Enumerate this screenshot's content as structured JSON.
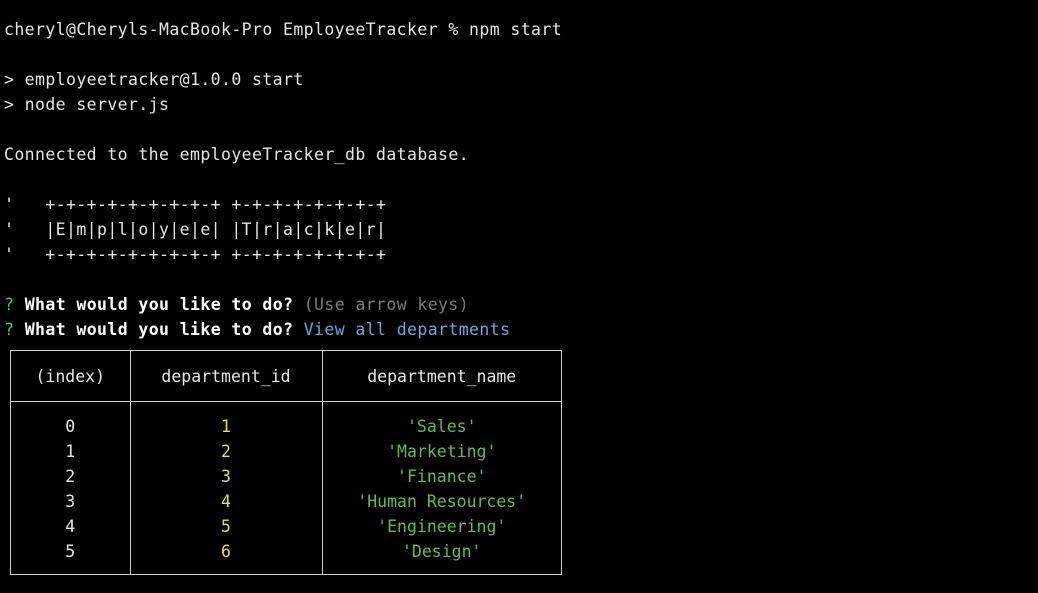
{
  "terminal": {
    "prompt_cmd": "cheryl@Cheryls-MacBook-Pro EmployeeTracker % npm start",
    "npm_line1": "> employeetracker@1.0.0 start",
    "npm_line2": "> node server.js",
    "connected": "Connected to the employeeTracker_db database.",
    "banner_top": "'   +-+-+-+-+-+-+-+-+ +-+-+-+-+-+-+-+",
    "banner_mid": "'   |E|m|p|l|o|y|e|e| |T|r|a|c|k|e|r|",
    "banner_bot": "'   +-+-+-+-+-+-+-+-+ +-+-+-+-+-+-+-+",
    "q_mark": "?",
    "question": "What would you like to do?",
    "hint": "(Use arrow keys)",
    "answer": "View all departments"
  },
  "table": {
    "headers": [
      "(index)",
      "department_id",
      "department_name"
    ],
    "rows": [
      {
        "index": "0",
        "id": "1",
        "name": "'Sales'"
      },
      {
        "index": "1",
        "id": "2",
        "name": "'Marketing'"
      },
      {
        "index": "2",
        "id": "3",
        "name": "'Finance'"
      },
      {
        "index": "3",
        "id": "4",
        "name": "'Human Resources'"
      },
      {
        "index": "4",
        "id": "5",
        "name": "'Engineering'"
      },
      {
        "index": "5",
        "id": "6",
        "name": "'Design'"
      }
    ]
  },
  "colors": {
    "background": "#000000",
    "text": "#e6e6e6",
    "prompt_green": "#5fbf4e",
    "answer_blue": "#6aa9e0",
    "number_yellow": "#e3e34a",
    "string_green": "#5fbf4e"
  }
}
